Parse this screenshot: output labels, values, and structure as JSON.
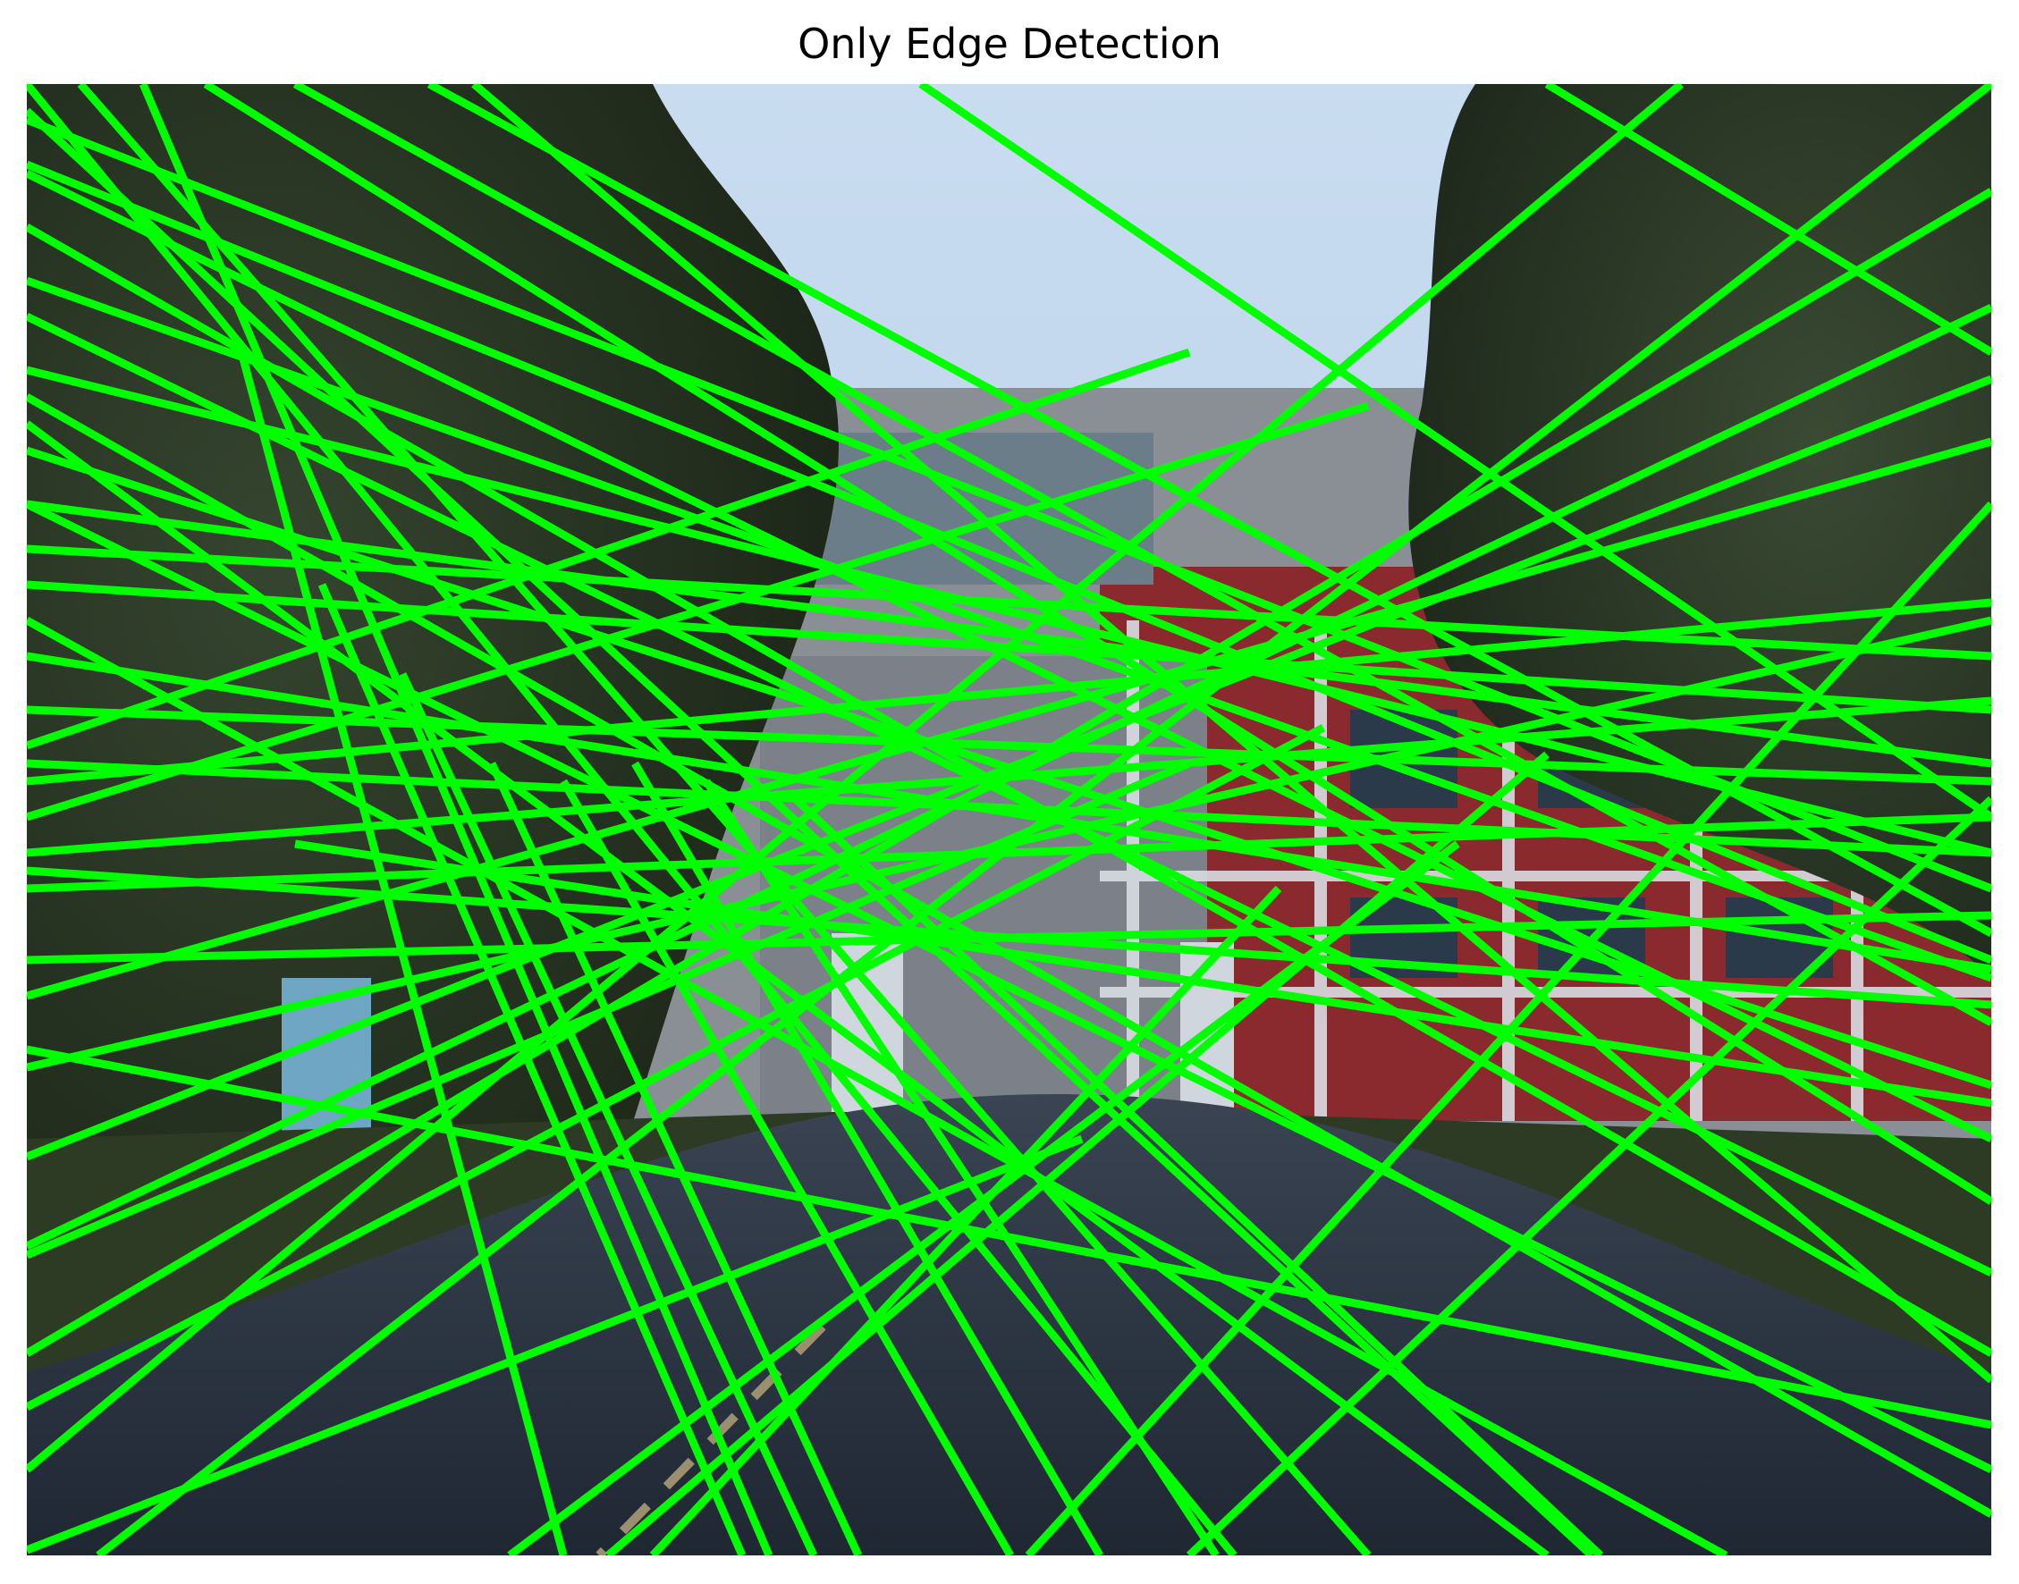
{
  "figure": {
    "title": "Only Edge Detection"
  },
  "overlay": {
    "line_color": "#00ff00"
  }
}
